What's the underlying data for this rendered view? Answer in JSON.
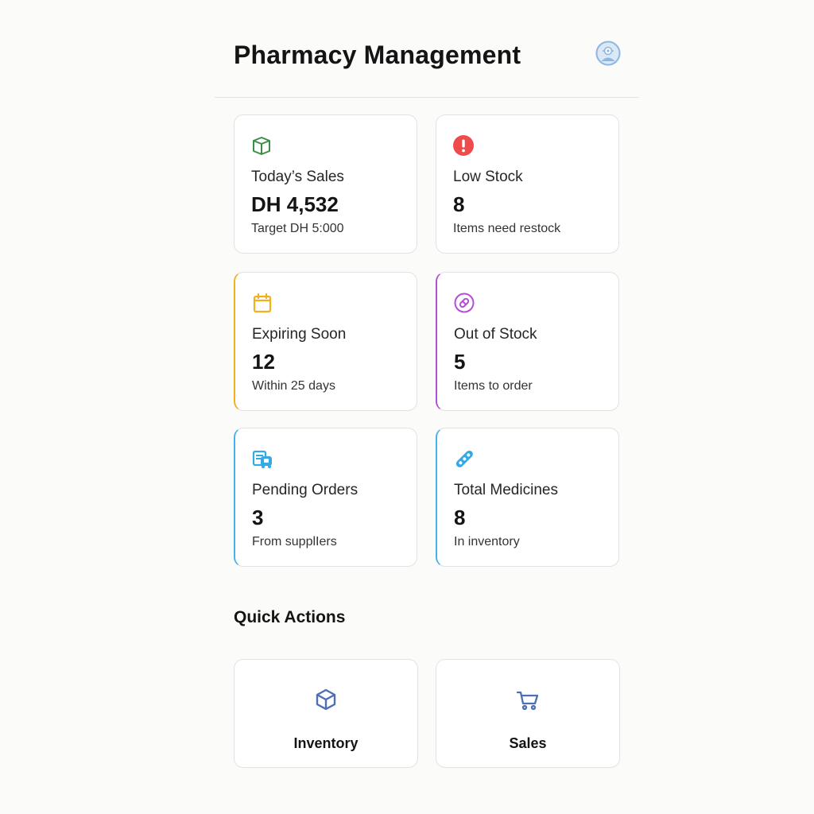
{
  "header": {
    "title": "Pharmacy Management",
    "avatar_icon": "user-avatar-icon"
  },
  "stats": [
    {
      "icon": "box-icon",
      "label": "Today’s Sales",
      "value": "DH 4,532",
      "sub": "Target DH 5:000",
      "accent": "#3d8b48"
    },
    {
      "icon": "alert-icon",
      "label": "Low Stock",
      "value": "8",
      "sub": "Items need restock",
      "accent": "#ef4b4b"
    },
    {
      "icon": "calendar-icon",
      "label": "Expiring Soon",
      "value": "12",
      "sub": "Within 25 days",
      "accent": "#f2b01e"
    },
    {
      "icon": "pill-icon",
      "label": "Out of Stock",
      "value": "5",
      "sub": "Items to order",
      "accent": "#b24fd6"
    },
    {
      "icon": "delivery-icon",
      "label": "Pending Orders",
      "value": "3",
      "sub": "From supplIers",
      "accent": "#34a9e6"
    },
    {
      "icon": "capsules-icon",
      "label": "Total Medicines",
      "value": "8",
      "sub": "In inventory",
      "accent": "#34a9e6"
    }
  ],
  "quick_actions": {
    "title": "Quick Actions",
    "items": [
      {
        "icon": "cube-icon",
        "label": "Inventory",
        "color": "#4d6fb3"
      },
      {
        "icon": "cart-icon",
        "label": "Sales",
        "color": "#4d6fb3"
      }
    ]
  }
}
